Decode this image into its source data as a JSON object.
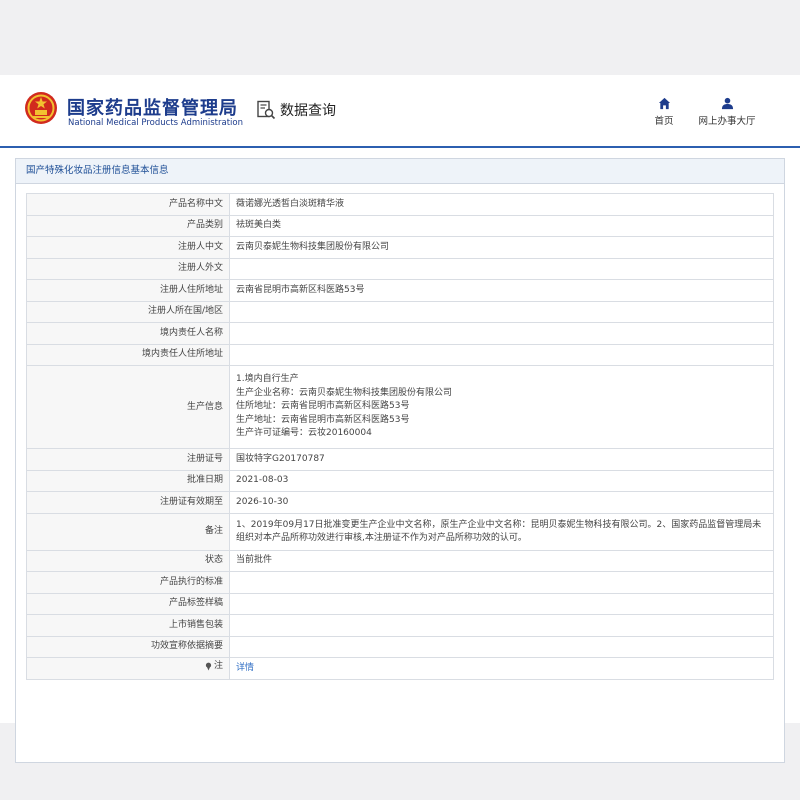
{
  "header": {
    "brand_cn": "国家药品监督管理局",
    "brand_en": "National Medical Products Administration",
    "data_query": "数据查询",
    "nav": [
      {
        "label": "首页",
        "icon": "home-icon"
      },
      {
        "label": "网上办事大厅",
        "icon": "user-icon"
      }
    ]
  },
  "panel": {
    "title": "国产特殊化妆品注册信息基本信息"
  },
  "colors": {
    "brand": "#1d3c8c",
    "rule": "#2c5fb0",
    "link": "#2f6ec4"
  },
  "rows": {
    "product_name_cn": {
      "label": "产品名称中文",
      "value": "薇诺娜光透皙白淡斑精华液"
    },
    "product_category": {
      "label": "产品类别",
      "value": "祛斑美白类"
    },
    "registrant_cn": {
      "label": "注册人中文",
      "value": "云南贝泰妮生物科技集团股份有限公司"
    },
    "registrant_foreign": {
      "label": "注册人外文",
      "value": ""
    },
    "registrant_address": {
      "label": "注册人住所地址",
      "value": "云南省昆明市高新区科医路53号"
    },
    "registrant_region": {
      "label": "注册人所在国/地区",
      "value": ""
    },
    "domestic_agent": {
      "label": "境内责任人名称",
      "value": ""
    },
    "domestic_agent_address": {
      "label": "境内责任人住所地址",
      "value": ""
    },
    "production_info": {
      "label": "生产信息",
      "lines": [
        "1.境内自行生产",
        "生产企业名称：云南贝泰妮生物科技集团股份有限公司",
        "住所地址：云南省昆明市高新区科医路53号",
        "生产地址：云南省昆明市高新区科医路53号",
        "生产许可证编号：云妆20160004"
      ]
    },
    "registration_no": {
      "label": "注册证号",
      "value": "国妆特字G20170787"
    },
    "approval_date": {
      "label": "批准日期",
      "value": "2021-08-03"
    },
    "validity_date": {
      "label": "注册证有效期至",
      "value": "2026-10-30"
    },
    "remarks": {
      "label": "备注",
      "value": "1、2019年09月17日批准变更生产企业中文名称，原生产企业中文名称：昆明贝泰妮生物科技有限公司。2、国家药品监督管理局未组织对本产品所称功效进行审核,本注册证不作为对产品所称功效的认可。"
    },
    "status": {
      "label": "状态",
      "value": "当前批件"
    },
    "standard": {
      "label": "产品执行的标准",
      "value": ""
    },
    "label_sample": {
      "label": "产品标签样稿",
      "value": ""
    },
    "packaging": {
      "label": "上市销售包装",
      "value": ""
    },
    "efficacy_basis": {
      "label": "功效宣称依据摘要",
      "value": ""
    },
    "note": {
      "label": "注",
      "value": "详情"
    }
  }
}
